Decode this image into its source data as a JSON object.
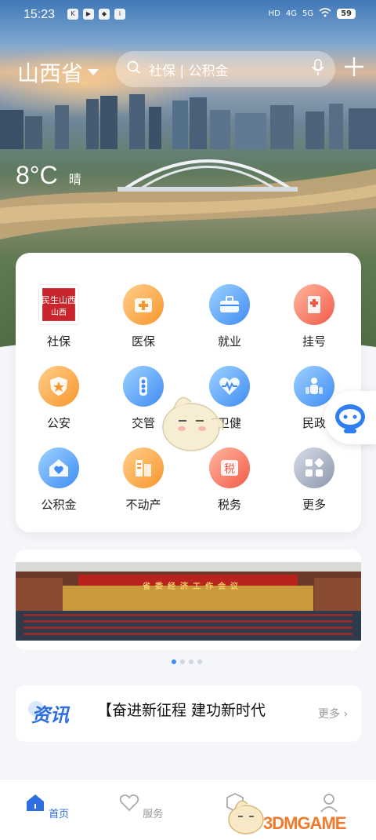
{
  "status_bar": {
    "time": "15:23",
    "network_labels": [
      "HD",
      "4G",
      "5G"
    ],
    "battery": "59"
  },
  "header": {
    "province": "山西省",
    "search_placeholder": "社保 | 公积金"
  },
  "weather": {
    "temperature": "8°C",
    "condition": "晴"
  },
  "services": [
    {
      "label": "社保",
      "icon": "shebao-logo-icon"
    },
    {
      "label": "医保",
      "icon": "medical-box-icon"
    },
    {
      "label": "就业",
      "icon": "briefcase-icon"
    },
    {
      "label": "挂号",
      "icon": "hospital-icon"
    },
    {
      "label": "公安",
      "icon": "police-badge-icon"
    },
    {
      "label": "交管",
      "icon": "traffic-light-icon"
    },
    {
      "label": "卫健",
      "icon": "heartbeat-icon"
    },
    {
      "label": "民政",
      "icon": "people-icon"
    },
    {
      "label": "公积金",
      "icon": "house-heart-icon"
    },
    {
      "label": "不动产",
      "icon": "property-icon"
    },
    {
      "label": "税务",
      "icon": "tax-icon"
    },
    {
      "label": "更多",
      "icon": "more-grid-icon"
    }
  ],
  "shebao_logo_text": "民生山西",
  "banner": {
    "caption": "省委经济工作会议",
    "page_count": 4,
    "active_page": 1
  },
  "news": {
    "tag": "资讯",
    "headline": "【奋进新征程 建功新时代",
    "more": "更多"
  },
  "bottom_nav": [
    {
      "label": "首页",
      "icon": "home-icon",
      "active": true
    },
    {
      "label": "服务",
      "icon": "heart-icon",
      "active": false
    },
    {
      "label": "",
      "icon": "hexagon-icon",
      "active": false
    },
    {
      "label": "",
      "icon": "user-icon",
      "active": false
    }
  ],
  "watermark": "3DMGAME",
  "colors": {
    "accent": "#2f6fe0",
    "orange": "#f7962c",
    "blue": "#3f8cf4",
    "red": "#f25a48",
    "gray": "#8d98ac"
  }
}
